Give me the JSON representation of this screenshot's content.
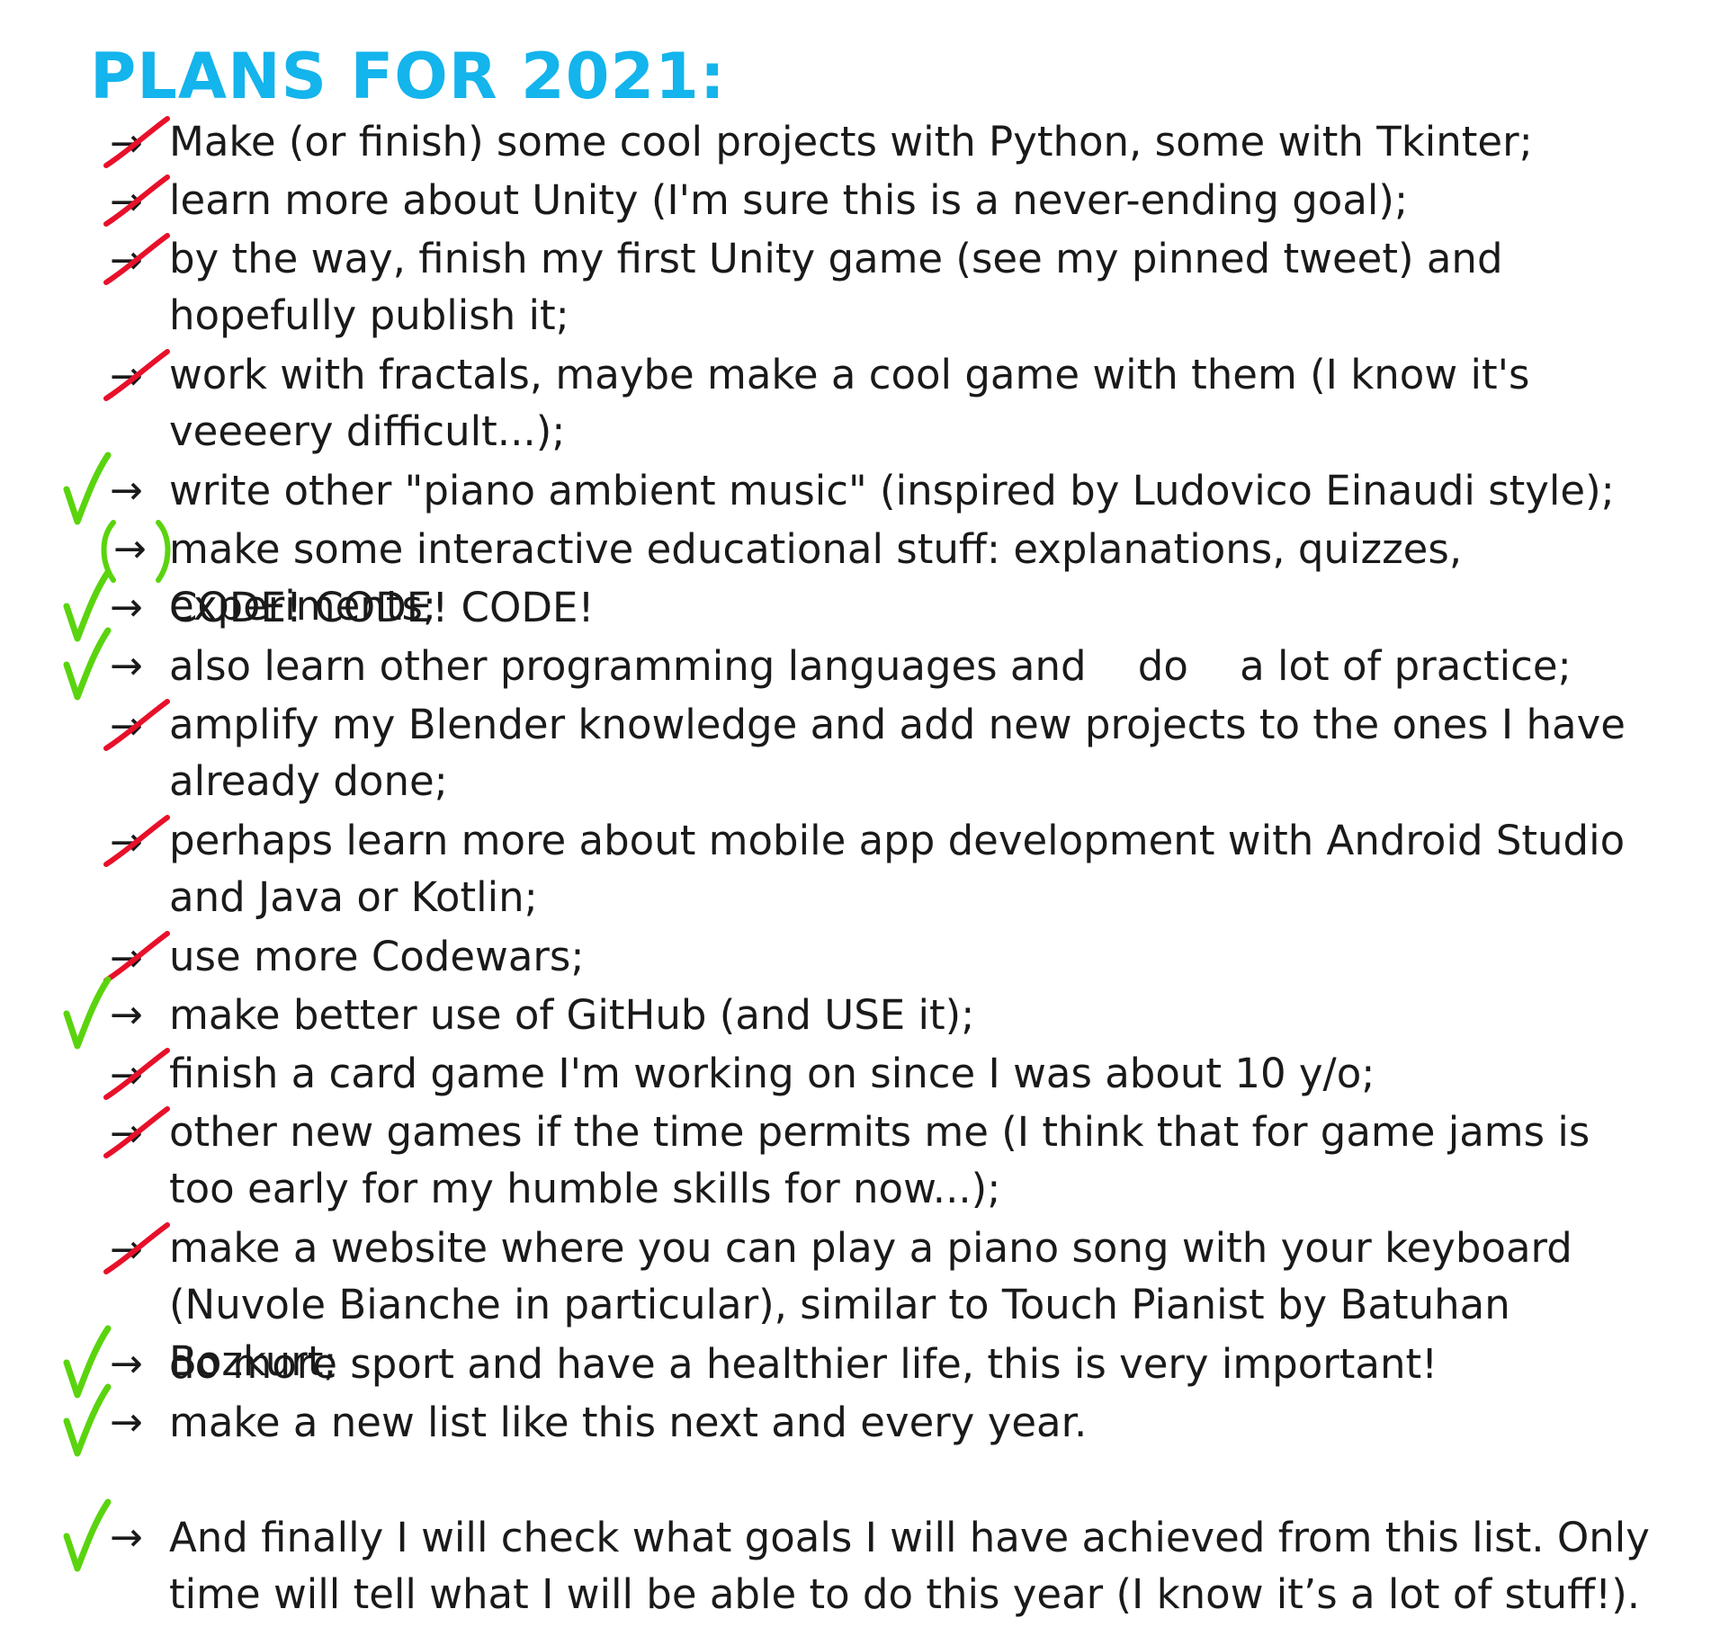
{
  "title": "PLANS FOR 2021:",
  "colors": {
    "title": "#14b4ec",
    "text": "#1a1a1a",
    "done_check": "#5ad40e",
    "struck": "#e8102a"
  },
  "arrow_glyph": "→",
  "items": [
    {
      "text": "Make (or finish) some cool projects with Python, some with Tkinter;",
      "status": "struck",
      "icon": "crossed-arrow-icon"
    },
    {
      "text": "learn more about Unity (I'm sure this is a never-ending goal);",
      "status": "struck",
      "icon": "crossed-arrow-icon"
    },
    {
      "text": "by the way, finish my first Unity game (see my pinned tweet) and hopefully publish it;",
      "status": "struck",
      "icon": "crossed-arrow-icon"
    },
    {
      "text": "work with fractals, maybe make a cool game with them (I know it's veeeery difficult...);",
      "status": "struck",
      "icon": "crossed-arrow-icon"
    },
    {
      "text": "write other \"piano ambient music\" (inspired by Ludovico Einaudi style);",
      "status": "done",
      "icon": "check-icon"
    },
    {
      "text": "make some interactive educational stuff: explanations, quizzes, experiments;",
      "status": "partial",
      "icon": "parenthesized-arrow-icon"
    },
    {
      "text": "CODE! CODE! CODE!",
      "status": "done",
      "icon": "check-icon"
    },
    {
      "text": "also learn other programming languages and    do    a lot of practice;",
      "status": "done",
      "icon": "check-icon"
    },
    {
      "text": "amplify my Blender knowledge and add new projects to the ones I have already done;",
      "status": "struck",
      "icon": "crossed-arrow-icon"
    },
    {
      "text": "perhaps learn more about mobile app development with Android Studio and Java or Kotlin;",
      "status": "struck",
      "icon": "crossed-arrow-icon"
    },
    {
      "text": "use more Codewars;",
      "status": "struck",
      "icon": "crossed-arrow-icon"
    },
    {
      "text": "make better use of GitHub (and USE it);",
      "status": "done",
      "icon": "check-icon"
    },
    {
      "text": "finish a card game I'm working on since I was about 10 y/o;",
      "status": "struck",
      "icon": "crossed-arrow-icon"
    },
    {
      "text": "other new games if the time permits me (I think that for game jams is too early for my humble skills for now...);",
      "status": "struck",
      "icon": "crossed-arrow-icon"
    },
    {
      "text": "make a website where you can play a piano song with your keyboard (Nuvole Bianche in particular), similar to Touch Pianist by Batuhan Bozkurt;",
      "status": "struck",
      "icon": "crossed-arrow-icon"
    },
    {
      "text": "do more sport and have a healthier life, this is very important!",
      "status": "done",
      "icon": "check-icon"
    },
    {
      "text": "make a new list like this next and every year.",
      "status": "done",
      "icon": "check-icon"
    },
    {
      "text": "And finally I will check what goals I will have achieved from this list. Only time will tell what I will be able to do this year (I know it’s a lot of stuff!).",
      "status": "done",
      "icon": "check-icon"
    }
  ]
}
